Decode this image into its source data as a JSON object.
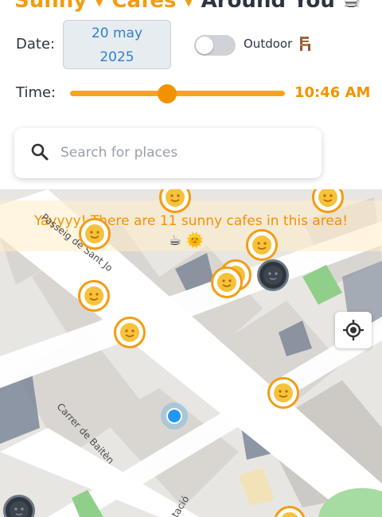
{
  "header": {
    "title_part1": "Sunny",
    "title_part2": "Cafes",
    "title_part3": "Around You",
    "title_emoji": "☕"
  },
  "controls": {
    "date_label": "Date:",
    "date_value_line1": "20 may",
    "date_value_line2": "2025",
    "outdoor_label": "Outdoor",
    "outdoor_enabled": false,
    "time_label": "Time:",
    "time_value": "10:46 AM",
    "time_slider_fraction": 0.45
  },
  "search": {
    "placeholder": "Search for places"
  },
  "map": {
    "banner_text": "Yayyyy! There are 11 sunny cafes in this area!",
    "banner_icons": "☕ 🌞",
    "streets": {
      "street1": "Passeig de Sant Jo",
      "street2": "Carrer de Baitèn",
      "street3": "tació"
    }
  },
  "colors": {
    "accent": "#f39200",
    "date_text": "#2f80c8",
    "sun_pin_border": "#f39c12",
    "night_pin": "#30363d"
  },
  "icons": {
    "search": "search-icon",
    "chair": "chair-icon",
    "locate": "locate-icon",
    "sun": "sun-face-icon",
    "moon": "new-moon-face-icon"
  }
}
